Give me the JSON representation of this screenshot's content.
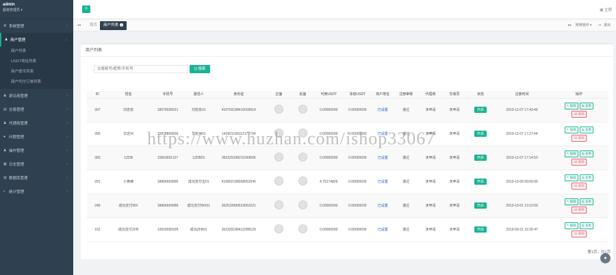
{
  "user": {
    "name": "admin",
    "role": "超级管理员 ▾"
  },
  "menu": [
    {
      "label": "系统管理",
      "icon": "gear-icon",
      "glyph": "⚙"
    },
    {
      "label": "商户管理",
      "icon": "person-icon",
      "glyph": "♟",
      "active": true,
      "children": [
        "商户列表",
        "USDT地址列表",
        "商户提币列表",
        "商户代付订单列表"
      ]
    },
    {
      "label": "承兑商管理",
      "icon": "person-icon",
      "glyph": "♟"
    },
    {
      "label": "交易管理",
      "icon": "book-icon",
      "glyph": "▤"
    },
    {
      "label": "代理商管理",
      "icon": "person-icon",
      "glyph": "♟"
    },
    {
      "label": "问题管理",
      "icon": "chat-icon",
      "glyph": "●"
    },
    {
      "label": "操作管理",
      "icon": "person-icon",
      "glyph": "♟"
    },
    {
      "label": "日志管理",
      "icon": "list-icon",
      "glyph": "▦"
    },
    {
      "label": "数据库管理",
      "icon": "database-icon",
      "glyph": "▥"
    },
    {
      "label": "统计管理",
      "icon": "chart-icon",
      "glyph": "◐"
    }
  ],
  "topbar": {
    "theme": "主题"
  },
  "tabs": {
    "home": "首页",
    "active": "商户列表"
  },
  "tab_tools": {
    "close_ops": "常用操作 ▾",
    "exit": "退出"
  },
  "panel": {
    "title": "商户列表"
  },
  "search": {
    "placeholder": "交易账号/昵称/手机号",
    "button": "Q 搜索"
  },
  "table": {
    "headers": [
      "ID",
      "姓名",
      "手机号",
      "激活人",
      "身份证",
      "正面",
      "反面",
      "可用USDT",
      "冻结USDT",
      "商户地址",
      "注册审核",
      "代理商",
      "交易员",
      "状态",
      "注册时间",
      "操作"
    ],
    "rows": [
      {
        "id": "397",
        "name": "刘忠泉",
        "phone": "18079035521",
        "activator": "刘忠泉01",
        "idcard": "410703198410028014",
        "usdt": "0.00000000",
        "frozen": "0.00000000",
        "addr": "已设置",
        "audit": "通过",
        "agent": "未申请",
        "trader": "未申请",
        "status": "开启",
        "time": "2019-11-07 17:43:49"
      },
      {
        "id": "395",
        "name": "华定州",
        "phone": "15878866836",
        "activator": "华定州01",
        "idcard": "142601199112177734",
        "usdt": "0.00000000",
        "frozen": "0.00000000",
        "addr": "已设置",
        "audit": "通过",
        "agent": "未申请",
        "trader": "未申请",
        "status": "开启",
        "time": "2019-11-07 17:27:44"
      },
      {
        "id": "393",
        "name": "1ZDB",
        "phone": "15563691127",
        "activator": "1ZDB01",
        "idcard": "362329198211093666",
        "usdt": "0.00000000",
        "frozen": "0.00000000",
        "addr": "已设置",
        "audit": "通过",
        "agent": "未申请",
        "trader": "未申请",
        "status": "开启",
        "time": "2019-11-07 17:14:50"
      },
      {
        "id": "291",
        "name": "小黄蜂",
        "phone": "18866669990",
        "activator": "成功支付宝01",
        "idcard": "410802198008052546",
        "usdt": "4.75174826",
        "frozen": "0.00000000",
        "addr": "已设置",
        "audit": "通过",
        "agent": "未申请",
        "trader": "未申请",
        "status": "开启",
        "time": "2019-10-09 00:56:06"
      },
      {
        "id": "249",
        "name": "成功支付WX",
        "phone": "18866669988",
        "activator": "成功支付WX01",
        "idcard": "362519990523653221",
        "usdt": "0.00000000",
        "frozen": "0.00000000",
        "addr": "已设置",
        "audit": "通过",
        "agent": "未申请",
        "trader": "未申请",
        "status": "开启",
        "time": "2019-10-01 13:10:59"
      },
      {
        "id": "152",
        "name": "成功支付ZFB",
        "phone": "13503095928",
        "activator": "成功ZFB01",
        "idcard": "362329198412288129",
        "usdt": "0.00000000",
        "frozen": "0.00000000",
        "addr": "已设置",
        "audit": "通过",
        "agent": "未申请",
        "trader": "未申请",
        "status": "开启",
        "time": "2019-09-21 16:35:47"
      }
    ],
    "actions": {
      "edit": "编辑",
      "view": "查看",
      "delete": "删除"
    }
  },
  "pager": {
    "text": "第1页，共1页"
  },
  "watermark": "https://www.huzhan.com/ishop33067",
  "colors": {
    "sidebar": "#2f4050",
    "accent": "#1ab394",
    "danger": "#ed5565",
    "link": "#1a5bc4"
  }
}
